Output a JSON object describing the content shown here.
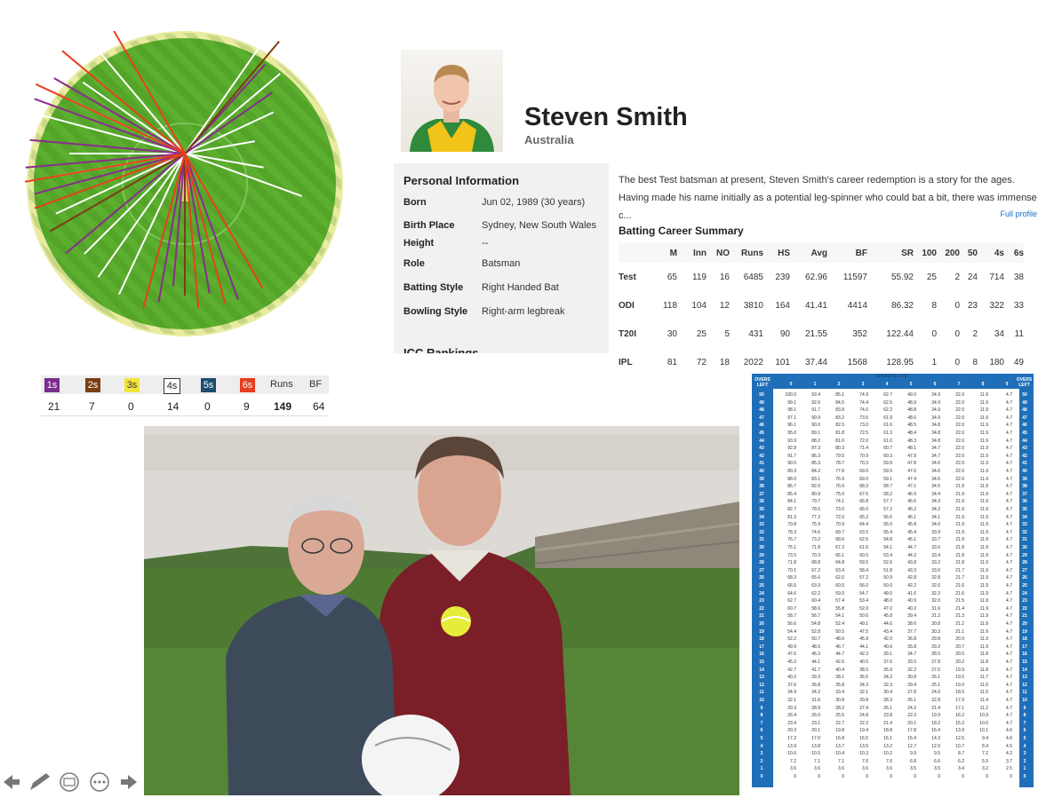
{
  "wagon_wheel": {
    "colors": {
      "field": "#5cae2e",
      "border": "#e9eca0",
      "ones": "#ffffff",
      "twos": "#7b3d15",
      "fours": "#8a2c8e",
      "sixes": "#e8401b"
    }
  },
  "profile": {
    "name": "Steven Smith",
    "country": "Australia",
    "personal_info_title": "Personal Information",
    "personal_info": [
      {
        "label": "Born",
        "value": "Jun 02, 1989 (30 years)"
      },
      {
        "label": "Birth Place",
        "value": "Sydney, New South Wales"
      },
      {
        "label": "Height",
        "value": "--"
      },
      {
        "label": "Role",
        "value": "Batsman"
      },
      {
        "label": "Batting Style",
        "value": "Right Handed Bat"
      },
      {
        "label": "Bowling Style",
        "value": "Right-arm legbreak"
      }
    ],
    "icc_rankings_title": "ICC Rankings",
    "bio": "The best Test batsman at present, Steven Smith's career redemption is a story for the ages. Having made his name initially as a potential leg-spinner who could bat a bit, there was immense c...",
    "full_profile_link": "Full profile",
    "batting_title": "Batting Career Summary",
    "batting_headers": [
      "",
      "M",
      "Inn",
      "NO",
      "Runs",
      "HS",
      "Avg",
      "BF",
      "SR",
      "100",
      "200",
      "50",
      "4s",
      "6s"
    ],
    "batting_rows": [
      [
        "Test",
        "65",
        "119",
        "16",
        "6485",
        "239",
        "62.96",
        "11597",
        "55.92",
        "25",
        "2",
        "24",
        "714",
        "38"
      ],
      [
        "ODI",
        "118",
        "104",
        "12",
        "3810",
        "164",
        "41.41",
        "4414",
        "86.32",
        "8",
        "0",
        "23",
        "322",
        "33"
      ],
      [
        "T20I",
        "30",
        "25",
        "5",
        "431",
        "90",
        "21.55",
        "352",
        "122.44",
        "0",
        "0",
        "2",
        "34",
        "11"
      ],
      [
        "IPL",
        "81",
        "72",
        "18",
        "2022",
        "101",
        "37.44",
        "1568",
        "128.95",
        "1",
        "0",
        "8",
        "180",
        "49"
      ]
    ]
  },
  "breakdown": {
    "labels": [
      "1s",
      "2s",
      "3s",
      "4s",
      "5s",
      "6s",
      "Runs",
      "BF"
    ],
    "values": [
      "21",
      "7",
      "0",
      "14",
      "0",
      "9",
      "149",
      "64"
    ],
    "chip_colors": [
      "#7b2d8e",
      "#7a3d12",
      "#f2e43a",
      "#ffffff",
      "#1c4e6d",
      "#e63d1e"
    ]
  },
  "photo": {
    "colors": {
      "sky": "#ddd9d4",
      "grass": "#4f7a32",
      "wall": "#8e877a",
      "sweater": "#7a1f28",
      "jumper": "#3d4a5a"
    }
  },
  "dl_table": {
    "title": "WICKETS LOST",
    "overs_left_label": "OVERS LEFT",
    "wicket_headers": [
      "0",
      "1",
      "2",
      "3",
      "4",
      "5",
      "6",
      "7",
      "8",
      "9"
    ],
    "overs": [
      "50",
      "49",
      "48",
      "47",
      "46",
      "45",
      "44",
      "43",
      "42",
      "41",
      "40",
      "39",
      "38",
      "37",
      "36",
      "35",
      "34",
      "33",
      "32",
      "31",
      "30",
      "29",
      "28",
      "27",
      "26",
      "25",
      "24",
      "23",
      "22",
      "21",
      "20",
      "19",
      "18",
      "17",
      "16",
      "15",
      "14",
      "13",
      "12",
      "11",
      "10",
      "9",
      "8",
      "7",
      "6",
      "5",
      "4",
      "3",
      "2",
      "1",
      "0"
    ],
    "columns": [
      [
        "100.0",
        "99.1",
        "98.1",
        "97.1",
        "96.1",
        "95.0",
        "93.9",
        "92.8",
        "91.7",
        "90.5",
        "89.3",
        "88.0",
        "86.7",
        "85.4",
        "84.1",
        "82.7",
        "81.3",
        "79.8",
        "78.3",
        "76.7",
        "75.1",
        "73.5",
        "71.8",
        "70.1",
        "68.3",
        "66.5",
        "64.6",
        "62.7",
        "60.7",
        "58.7",
        "56.6",
        "54.4",
        "52.2",
        "49.9",
        "47.6",
        "45.2",
        "42.7",
        "40.2",
        "37.6",
        "34.9",
        "32.1",
        "29.3",
        "26.4",
        "23.4",
        "20.3",
        "17.2",
        "13.9",
        "10.6",
        "7.2",
        "3.6",
        "0"
      ],
      [
        "93.4",
        "92.6",
        "91.7",
        "90.9",
        "90.0",
        "89.1",
        "88.2",
        "87.3",
        "86.3",
        "85.3",
        "84.2",
        "83.1",
        "82.0",
        "80.9",
        "79.7",
        "78.5",
        "77.2",
        "75.9",
        "74.6",
        "73.2",
        "71.8",
        "70.3",
        "68.8",
        "67.2",
        "65.6",
        "63.9",
        "62.2",
        "60.4",
        "58.6",
        "56.7",
        "54.8",
        "52.8",
        "50.7",
        "48.5",
        "46.3",
        "44.1",
        "41.7",
        "39.3",
        "36.8",
        "34.2",
        "31.6",
        "28.9",
        "26.0",
        "23.1",
        "20.1",
        "17.0",
        "13.8",
        "10.5",
        "7.1",
        "3.6",
        "0"
      ],
      [
        "85.1",
        "84.5",
        "83.8",
        "83.2",
        "82.5",
        "81.8",
        "81.0",
        "80.3",
        "79.5",
        "78.7",
        "77.8",
        "76.9",
        "76.0",
        "75.0",
        "74.1",
        "73.0",
        "72.0",
        "70.9",
        "69.7",
        "68.6",
        "67.3",
        "66.1",
        "64.8",
        "63.4",
        "62.0",
        "60.5",
        "59.0",
        "57.4",
        "55.8",
        "54.1",
        "52.4",
        "50.5",
        "48.6",
        "46.7",
        "44.7",
        "42.6",
        "40.4",
        "38.1",
        "35.8",
        "33.4",
        "30.8",
        "28.2",
        "25.5",
        "22.7",
        "19.8",
        "16.8",
        "13.7",
        "10.4",
        "7.1",
        "3.6",
        "0"
      ],
      [
        "74.9",
        "74.4",
        "74.0",
        "73.5",
        "73.0",
        "72.5",
        "72.0",
        "71.4",
        "70.9",
        "70.3",
        "69.6",
        "69.0",
        "68.3",
        "67.6",
        "66.8",
        "66.0",
        "65.2",
        "64.4",
        "63.5",
        "62.5",
        "61.6",
        "60.5",
        "59.5",
        "58.4",
        "57.2",
        "56.0",
        "54.7",
        "53.4",
        "52.0",
        "50.6",
        "49.1",
        "47.5",
        "45.9",
        "44.1",
        "42.3",
        "40.5",
        "38.5",
        "36.5",
        "34.3",
        "32.1",
        "29.8",
        "27.4",
        "24.8",
        "22.2",
        "19.4",
        "16.5",
        "13.5",
        "10.3",
        "7.0",
        "3.6",
        "0"
      ],
      [
        "62.7",
        "62.5",
        "62.2",
        "61.9",
        "61.6",
        "61.3",
        "61.0",
        "60.7",
        "60.3",
        "59.9",
        "59.5",
        "59.1",
        "58.7",
        "58.2",
        "57.7",
        "57.2",
        "56.6",
        "56.0",
        "55.4",
        "54.8",
        "54.1",
        "53.4",
        "52.6",
        "51.8",
        "50.9",
        "50.0",
        "49.0",
        "48.0",
        "47.0",
        "45.8",
        "44.6",
        "43.4",
        "42.0",
        "40.6",
        "39.1",
        "37.6",
        "35.9",
        "34.2",
        "32.3",
        "30.4",
        "28.3",
        "26.1",
        "23.8",
        "21.4",
        "18.8",
        "16.1",
        "13.2",
        "10.2",
        "7.0",
        "3.6",
        "0"
      ],
      [
        "49.0",
        "48.9",
        "48.8",
        "48.6",
        "48.5",
        "48.4",
        "48.3",
        "48.1",
        "47.9",
        "47.8",
        "47.6",
        "47.4",
        "47.1",
        "46.9",
        "46.6",
        "46.2",
        "46.1",
        "45.8",
        "45.4",
        "45.1",
        "44.7",
        "44.2",
        "43.8",
        "43.3",
        "42.8",
        "42.2",
        "41.6",
        "40.9",
        "40.2",
        "39.4",
        "38.6",
        "37.7",
        "36.8",
        "35.8",
        "34.7",
        "33.5",
        "32.2",
        "30.8",
        "29.4",
        "27.8",
        "26.1",
        "24.2",
        "22.3",
        "20.1",
        "17.8",
        "15.4",
        "12.7",
        "9.9",
        "6.8",
        "3.5",
        "0"
      ],
      [
        "34.9",
        "34.9",
        "34.9",
        "34.9",
        "34.8",
        "34.8",
        "34.8",
        "34.7",
        "34.7",
        "34.6",
        "34.6",
        "34.5",
        "34.5",
        "34.4",
        "34.3",
        "34.2",
        "34.1",
        "34.0",
        "33.9",
        "33.7",
        "33.6",
        "33.4",
        "33.2",
        "33.0",
        "32.8",
        "32.6",
        "32.3",
        "32.0",
        "31.6",
        "31.2",
        "30.8",
        "30.3",
        "29.8",
        "29.2",
        "28.5",
        "27.8",
        "27.0",
        "26.1",
        "25.1",
        "24.0",
        "22.8",
        "21.4",
        "19.9",
        "18.2",
        "16.4",
        "14.3",
        "12.0",
        "9.5",
        "6.6",
        "3.5",
        "0"
      ],
      [
        "22.0",
        "22.0",
        "22.0",
        "22.0",
        "22.0",
        "22.0",
        "22.0",
        "22.0",
        "22.0",
        "22.0",
        "22.0",
        "22.0",
        "21.9",
        "21.9",
        "21.9",
        "21.9",
        "21.9",
        "21.9",
        "21.9",
        "21.9",
        "21.8",
        "21.8",
        "21.8",
        "21.7",
        "21.7",
        "21.6",
        "21.6",
        "21.5",
        "21.4",
        "21.3",
        "21.2",
        "21.1",
        "20.9",
        "20.7",
        "20.5",
        "20.2",
        "19.9",
        "19.5",
        "19.0",
        "18.5",
        "17.9",
        "17.1",
        "16.2",
        "15.2",
        "13.9",
        "12.5",
        "10.7",
        "8.7",
        "6.2",
        "3.4",
        "0"
      ],
      [
        "11.9",
        "11.9",
        "11.9",
        "11.9",
        "11.9",
        "11.9",
        "11.9",
        "11.9",
        "11.9",
        "11.9",
        "11.9",
        "11.9",
        "11.9",
        "11.9",
        "11.9",
        "11.9",
        "11.9",
        "11.9",
        "11.9",
        "11.9",
        "11.9",
        "11.9",
        "11.9",
        "11.9",
        "11.9",
        "11.9",
        "11.9",
        "11.9",
        "11.9",
        "11.9",
        "11.9",
        "11.9",
        "11.9",
        "11.9",
        "11.8",
        "11.8",
        "11.8",
        "11.7",
        "11.6",
        "11.5",
        "11.4",
        "11.2",
        "10.9",
        "10.5",
        "10.1",
        "9.4",
        "8.4",
        "7.2",
        "5.5",
        "3.2",
        "0"
      ],
      [
        "4.7",
        "4.7",
        "4.7",
        "4.7",
        "4.7",
        "4.7",
        "4.7",
        "4.7",
        "4.7",
        "4.7",
        "4.7",
        "4.7",
        "4.7",
        "4.7",
        "4.7",
        "4.7",
        "4.7",
        "4.7",
        "4.7",
        "4.7",
        "4.7",
        "4.7",
        "4.7",
        "4.7",
        "4.7",
        "4.7",
        "4.7",
        "4.7",
        "4.7",
        "4.7",
        "4.7",
        "4.7",
        "4.7",
        "4.7",
        "4.7",
        "4.7",
        "4.7",
        "4.7",
        "4.7",
        "4.7",
        "4.7",
        "4.7",
        "4.7",
        "4.7",
        "4.6",
        "4.6",
        "4.5",
        "4.2",
        "3.7",
        "2.5",
        "0"
      ]
    ]
  },
  "nav": {
    "icons": [
      "arrow-left-icon",
      "pen-icon",
      "subtitles-icon",
      "more-icon",
      "arrow-right-icon"
    ]
  }
}
